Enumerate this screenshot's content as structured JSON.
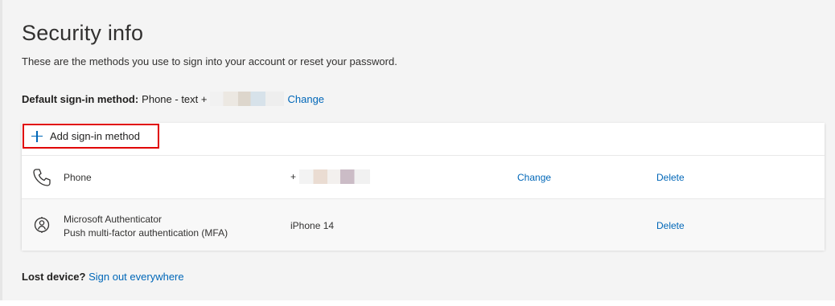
{
  "header": {
    "title": "Security info",
    "subtitle": "These are the methods you use to sign into your account or reset your password."
  },
  "default_method": {
    "label": "Default sign-in method:",
    "value": "Phone - text +",
    "change_link": "Change"
  },
  "add_method": {
    "label": "Add sign-in method",
    "icon": "plus-icon"
  },
  "methods": [
    {
      "icon": "phone-icon",
      "name": "Phone",
      "description": "",
      "detail": "+",
      "change_link": "Change",
      "delete_link": "Delete"
    },
    {
      "icon": "authenticator-icon",
      "name": "Microsoft Authenticator",
      "description": "Push multi-factor authentication (MFA)",
      "detail": "iPhone 14",
      "change_link": "",
      "delete_link": "Delete"
    }
  ],
  "lost_device": {
    "label": "Lost device?",
    "link": "Sign out everywhere"
  },
  "colors": {
    "link": "#0067b8",
    "highlight_border": "#e00000",
    "page_background": "#f4f4f4"
  }
}
